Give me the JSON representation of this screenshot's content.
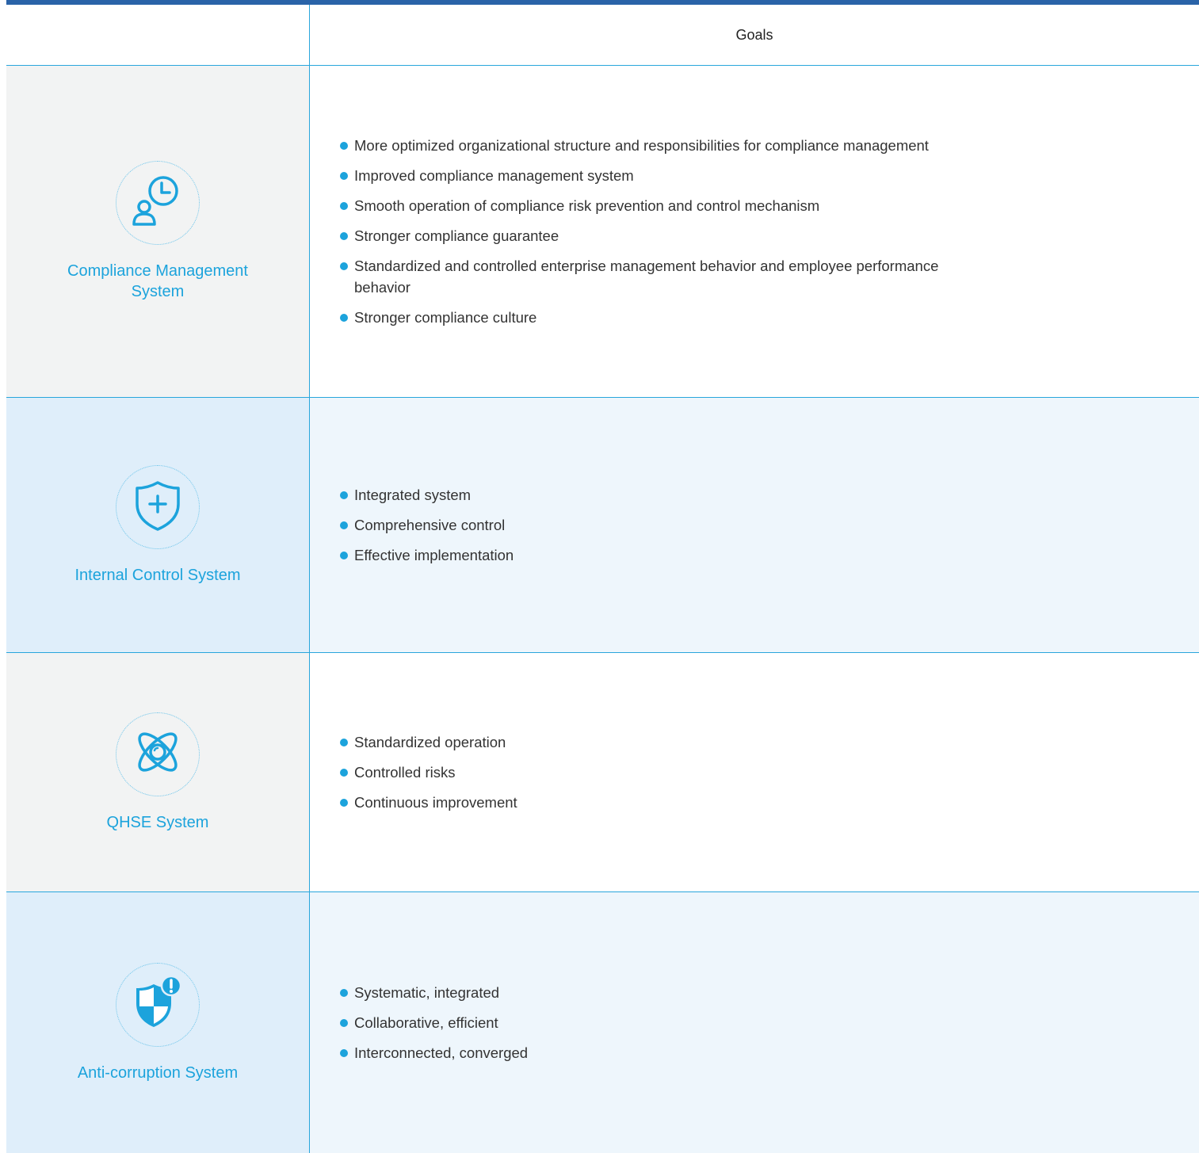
{
  "header": {
    "goals_label": "Goals"
  },
  "colors": {
    "accent": "#1ca3dc",
    "top_bar": "#2a63a8",
    "row_gray": "#f2f3f3",
    "row_blue": "#dfeefa"
  },
  "rows": [
    {
      "icon": "person-clock-icon",
      "label": "Compliance Management System",
      "goals": [
        "More optimized organizational structure and responsibilities for compliance management",
        "Improved compliance management system",
        "Smooth operation of compliance risk prevention and control mechanism",
        "Stronger compliance guarantee",
        "Standardized and controlled enterprise management behavior and employee performance behavior",
        "Stronger compliance culture"
      ]
    },
    {
      "icon": "shield-plus-icon",
      "label": "Internal Control System",
      "goals": [
        "Integrated system",
        "Comprehensive control",
        "Effective implementation"
      ]
    },
    {
      "icon": "atom-icon",
      "label": "QHSE System",
      "goals": [
        "Standardized operation",
        "Controlled risks",
        "Continuous improvement"
      ]
    },
    {
      "icon": "shield-alert-icon",
      "label": "Anti-corruption System",
      "goals": [
        "Systematic, integrated",
        "Collaborative, efficient",
        "Interconnected, converged"
      ]
    }
  ]
}
